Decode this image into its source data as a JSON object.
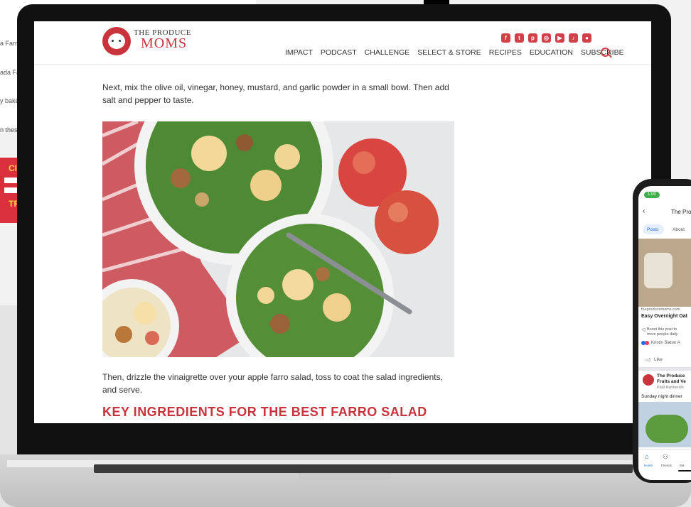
{
  "background": {
    "text_lines": [
      "a Farm",
      "ada Fa",
      "y bake",
      "n these"
    ],
    "banner_letters": [
      "CI",
      "TRI"
    ]
  },
  "site": {
    "logo_line1": "THE PRODUCE",
    "logo_line2": "MOMS",
    "social_icons": [
      "facebook-icon",
      "twitter-icon",
      "pinterest-icon",
      "instagram-icon",
      "youtube-icon",
      "tiktok-icon",
      "podcast-icon"
    ],
    "nav": [
      "IMPACT",
      "PODCAST",
      "CHALLENGE",
      "SELECT & STORE",
      "RECIPES",
      "EDUCATION",
      "SUBSCRIBE"
    ],
    "accent": "#c8333c"
  },
  "article": {
    "paragraph1": "Next, mix the olive oil, vinegar, honey, mustard, and garlic powder in a small bowl. Then add salt and pepper to taste.",
    "paragraph2": "Then, drizzle the vinaigrette over your apple farro salad, toss to coat the salad ingredients, and serve.",
    "heading": "KEY INGREDIENTS FOR THE BEST FARRO SALAD"
  },
  "phone": {
    "time": "1:00",
    "page_title": "The Pro",
    "tabs": [
      "Posts",
      "About"
    ],
    "link_domain": "theproducemoms.com",
    "link_title": "Easy Overnight Oat",
    "boost_text": "Boost this post to",
    "boost_text2": "more people daily",
    "reactions": "Kristin Slaton A",
    "like": "Like",
    "post2_name": "The Produce",
    "post2_name2": "Fruits and Ve",
    "post2_sub": "Paid Partnershi",
    "post2_text": "Sunday night dinner",
    "bottom_nav": [
      "Home",
      "Friends",
      "Ma"
    ]
  }
}
